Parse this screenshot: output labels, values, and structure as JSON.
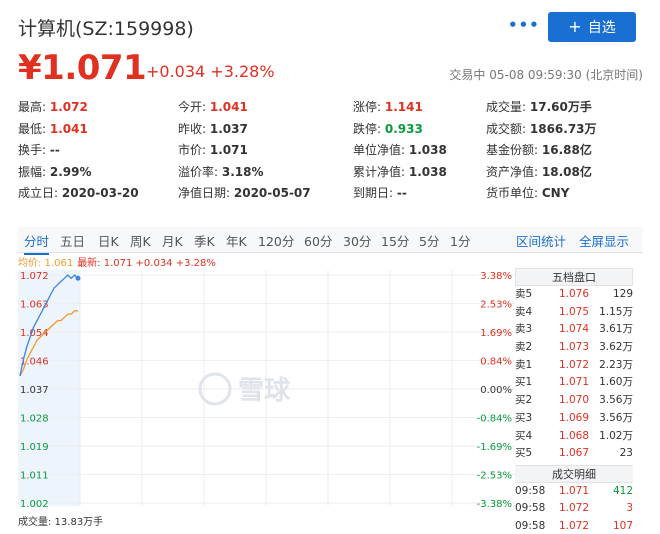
{
  "header": {
    "title": "计算机(SZ:159998)",
    "more_label": "•••",
    "add_label": "自选"
  },
  "price": {
    "symbol_price": "¥1.071",
    "change": "+0.034 +3.28%",
    "status": "交易中 05-08 09:59:30 (北京时间)"
  },
  "quote_rows": [
    [
      {
        "k": "最高:",
        "v": "1.072",
        "c": "red"
      },
      {
        "k": "今开:",
        "v": "1.041",
        "c": "red"
      },
      {
        "k": "涨停:",
        "v": "1.141",
        "c": "red"
      },
      {
        "k": "成交量:",
        "v": "17.60万手",
        "c": ""
      }
    ],
    [
      {
        "k": "最低:",
        "v": "1.041",
        "c": "red"
      },
      {
        "k": "昨收:",
        "v": "1.037",
        "c": ""
      },
      {
        "k": "跌停:",
        "v": "0.933",
        "c": "green"
      },
      {
        "k": "成交额:",
        "v": "1866.73万",
        "c": ""
      }
    ],
    [
      {
        "k": "换手:",
        "v": "--",
        "c": ""
      },
      {
        "k": "市价:",
        "v": "1.071",
        "c": ""
      },
      {
        "k": "单位净值:",
        "v": "1.038",
        "c": ""
      },
      {
        "k": "基金份额:",
        "v": "16.88亿",
        "c": ""
      }
    ],
    [
      {
        "k": "振幅:",
        "v": "2.99%",
        "c": ""
      },
      {
        "k": "溢价率:",
        "v": "3.18%",
        "c": ""
      },
      {
        "k": "累计净值:",
        "v": "1.038",
        "c": ""
      },
      {
        "k": "资产净值:",
        "v": "18.08亿",
        "c": ""
      }
    ],
    [
      {
        "k": "成立日:",
        "v": "2020-03-20",
        "c": ""
      },
      {
        "k": "净值日期:",
        "v": "2020-05-07",
        "c": ""
      },
      {
        "k": "到期日:",
        "v": "--",
        "c": ""
      },
      {
        "k": "货币单位:",
        "v": "CNY",
        "c": ""
      }
    ]
  ],
  "tabs": [
    "分时",
    "五日",
    "日K",
    "周K",
    "月K",
    "季K",
    "年K",
    "120分",
    "60分",
    "30分",
    "15分",
    "5分",
    "1分"
  ],
  "tabs_right": [
    "区间统计",
    "全屏显示"
  ],
  "legend": {
    "avg": "均价: 1.061",
    "last": "最新: 1.071 +0.034 +3.28%"
  },
  "volume_label": "成交量: 13.83万手",
  "watermark": "雪球",
  "chart_data": {
    "type": "line",
    "y_left_ticks": [
      "1.072",
      "1.063",
      "1.054",
      "1.046",
      "1.037",
      "1.028",
      "1.019",
      "1.011",
      "1.002"
    ],
    "y_right_ticks": [
      "3.38%",
      "2.53%",
      "1.69%",
      "0.84%",
      "0.00%",
      "-0.84%",
      "-1.69%",
      "-2.53%",
      "-3.38%"
    ],
    "ylim": [
      1.002,
      1.072
    ],
    "prev_close": 1.037,
    "series": [
      {
        "name": "最新",
        "color": "#3a86e0",
        "values": [
          1.041,
          1.046,
          1.05,
          1.053,
          1.056,
          1.058,
          1.06,
          1.062,
          1.064,
          1.066,
          1.068,
          1.069,
          1.07,
          1.071,
          1.072,
          1.071,
          1.072,
          1.071
        ]
      },
      {
        "name": "均价",
        "color": "#f39a2b",
        "values": [
          1.041,
          1.043,
          1.046,
          1.048,
          1.05,
          1.052,
          1.053,
          1.054,
          1.055,
          1.056,
          1.057,
          1.058,
          1.058,
          1.059,
          1.06,
          1.06,
          1.061,
          1.061
        ]
      }
    ]
  },
  "order_book": {
    "title": "五档盘口",
    "rows": [
      {
        "label": "卖5",
        "price": "1.076",
        "vol": "129"
      },
      {
        "label": "卖4",
        "price": "1.075",
        "vol": "1.15万"
      },
      {
        "label": "卖3",
        "price": "1.074",
        "vol": "3.61万"
      },
      {
        "label": "卖2",
        "price": "1.073",
        "vol": "3.62万"
      },
      {
        "label": "卖1",
        "price": "1.072",
        "vol": "2.23万"
      },
      {
        "label": "买1",
        "price": "1.071",
        "vol": "1.60万"
      },
      {
        "label": "买2",
        "price": "1.070",
        "vol": "3.56万"
      },
      {
        "label": "买3",
        "price": "1.069",
        "vol": "3.56万"
      },
      {
        "label": "买4",
        "price": "1.068",
        "vol": "1.02万"
      },
      {
        "label": "买5",
        "price": "1.067",
        "vol": "23"
      }
    ]
  },
  "deals": {
    "title": "成交明细",
    "rows": [
      {
        "time": "09:58",
        "price": "1.071",
        "vol": "412",
        "vc": "#0a9a3c"
      },
      {
        "time": "09:58",
        "price": "1.072",
        "vol": "3",
        "vc": "#e03020"
      },
      {
        "time": "09:58",
        "price": "1.072",
        "vol": "107",
        "vc": "#e03020"
      }
    ]
  }
}
